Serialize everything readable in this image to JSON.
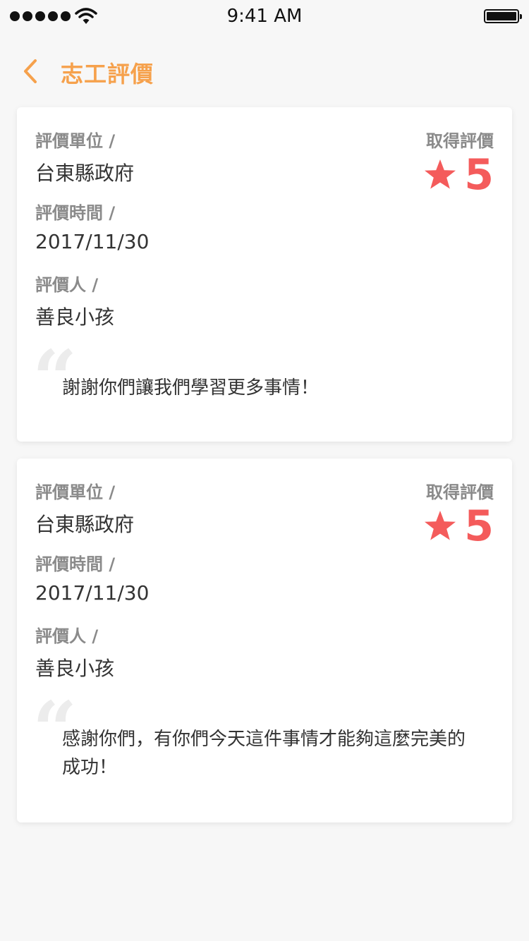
{
  "status_bar": {
    "time": "9:41 AM",
    "signal_icon": "signal-dots-icon",
    "wifi_icon": "wifi-icon",
    "battery_icon": "battery-icon"
  },
  "header": {
    "back_icon": "chevron-left-icon",
    "title": "志工評價"
  },
  "colors": {
    "accent": "#f6a14c",
    "rating": "#f45b5b",
    "label": "#8a8a8a"
  },
  "reviews": [
    {
      "unit_label": "評價單位 /",
      "unit": "台東縣政府",
      "time_label": "評價時間 /",
      "time": "2017/11/30",
      "reviewer_label": "評價人 /",
      "reviewer": "善良小孩",
      "rating_label": "取得評價",
      "rating": "5",
      "comment": "謝謝你們讓我們學習更多事情！"
    },
    {
      "unit_label": "評價單位 /",
      "unit": "台東縣政府",
      "time_label": "評價時間 /",
      "time": "2017/11/30",
      "reviewer_label": "評價人 /",
      "reviewer": "善良小孩",
      "rating_label": "取得評價",
      "rating": "5",
      "comment": "感謝你們，有你們今天這件事情才能夠這麼完美的成功！"
    }
  ]
}
